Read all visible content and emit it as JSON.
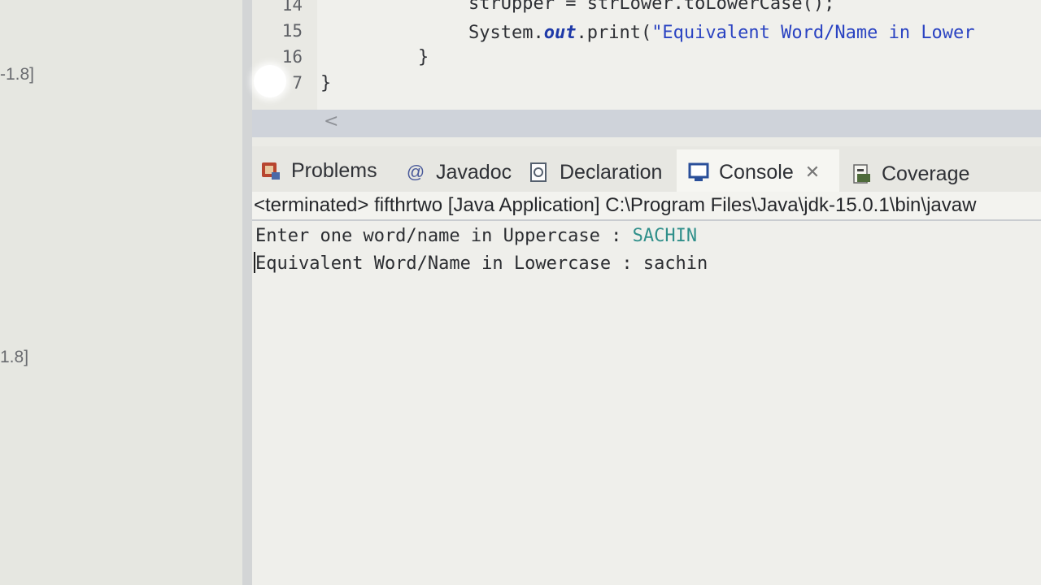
{
  "left_pane": {
    "fragments": [
      "-1.8]",
      "1.8]"
    ]
  },
  "editor": {
    "lines": [
      {
        "num": "14",
        "code": "strUpper = strLower.toLowerCase();"
      },
      {
        "num": "15",
        "code_prefix": "System.",
        "code_italic": "out",
        "code_mid": ".print(",
        "code_string": "\"Equivalent Word/Name in Lower"
      },
      {
        "num": "16",
        "code": "}"
      },
      {
        "num": "7",
        "code": "}"
      }
    ],
    "scroll_arrow": "<"
  },
  "tabs": [
    {
      "label": "Problems",
      "icon": "problems-icon"
    },
    {
      "label": "Javadoc",
      "icon": "at-icon"
    },
    {
      "label": "Declaration",
      "icon": "declaration-icon"
    },
    {
      "label": "Console",
      "icon": "console-icon",
      "active": true
    },
    {
      "label": "Coverage",
      "icon": "coverage-icon"
    }
  ],
  "console": {
    "header": "<terminated> fifthrtwo [Java Application] C:\\Program Files\\Java\\jdk-15.0.1\\bin\\javaw",
    "line1_prompt": "Enter one word/name in Uppercase : ",
    "line1_input": "SACHIN",
    "line2": "Equivalent Word/Name in Lowercase : sachin"
  },
  "colors": {
    "input_text": "#2f8f8a",
    "string_literal": "#2a43c2",
    "keyword_italic": "#1f3aa8"
  }
}
